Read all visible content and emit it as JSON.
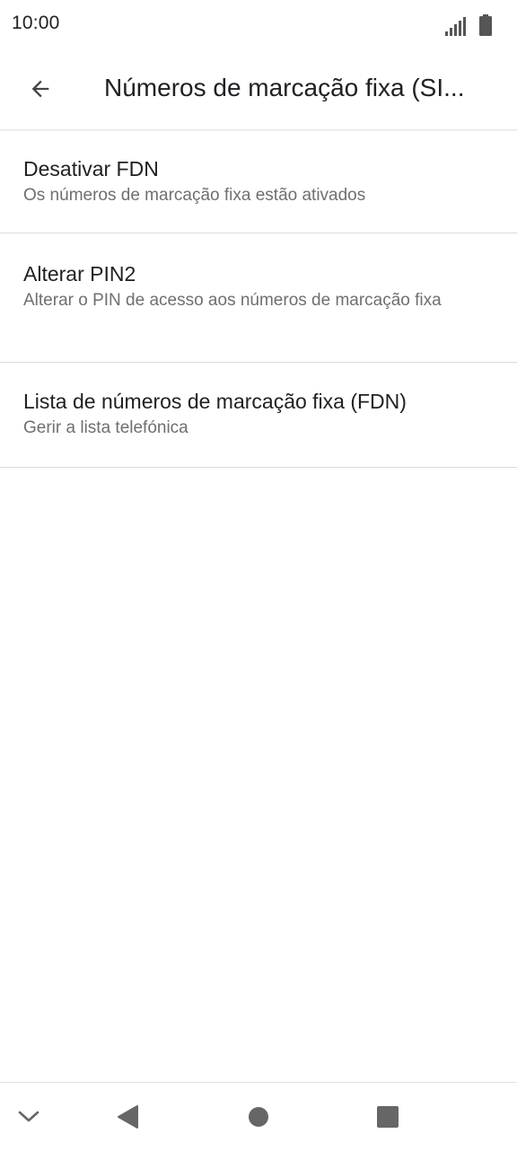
{
  "status_bar": {
    "time": "10:00",
    "icons": [
      "signal-icon",
      "battery-icon"
    ]
  },
  "app_bar": {
    "back_icon": "arrow-left-icon",
    "title": "Números de marcação fixa (SI..."
  },
  "settings": {
    "items": [
      {
        "title": "Desativar FDN",
        "summary": "Os números de marcação fixa estão ativados"
      },
      {
        "title": "Alterar PIN2",
        "summary": "Alterar o PIN de acesso aos números de marcação fixa"
      },
      {
        "title": "Lista de números de marcação fixa (FDN)",
        "summary": "Gerir a lista telefónica"
      }
    ]
  },
  "nav_bar": {
    "icons": [
      "chevron-down-icon",
      "back-triangle-icon",
      "home-circle-icon",
      "recents-square-icon"
    ]
  },
  "colors": {
    "text_primary": "#202124",
    "text_secondary": "#6f6f6f",
    "divider": "#dadada",
    "icon": "#555555"
  }
}
